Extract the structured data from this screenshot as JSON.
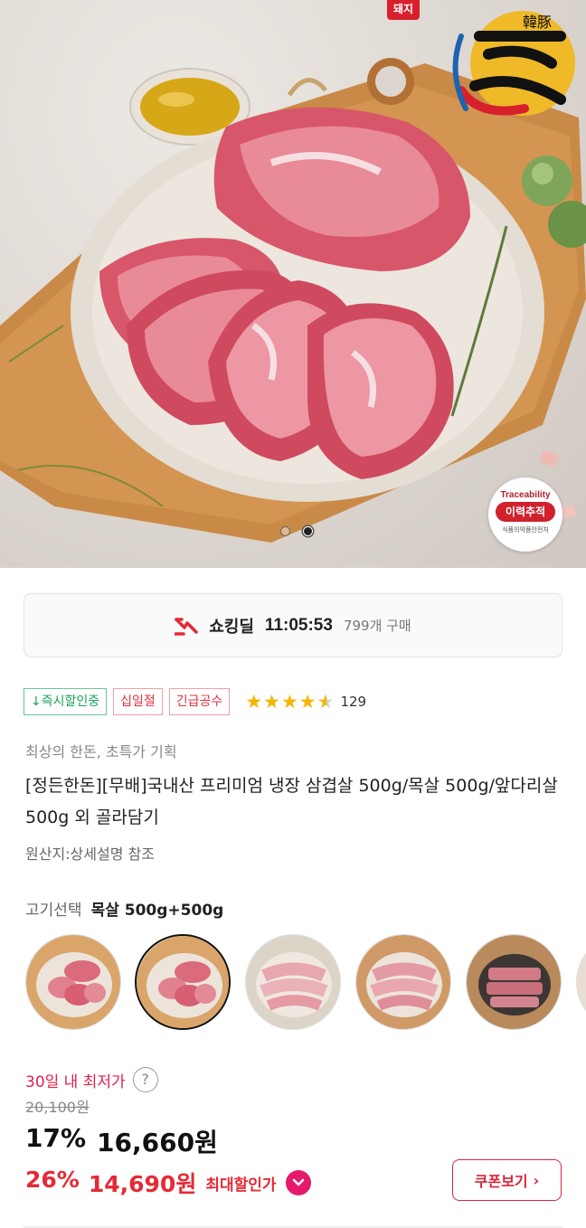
{
  "hero": {
    "brand_tag": "돼지",
    "brand_hanja": "韓豚",
    "brand_name": "한돈",
    "trace_badge_top": "Traceability",
    "trace_badge_main": "이력추적",
    "trace_badge_sub": "식품의약품안전처",
    "slide_count": 2,
    "active_slide": 2
  },
  "deal": {
    "label": "쇼킹딜",
    "timer": "11:05:53",
    "purchase_count": "799개 구매",
    "accent_color": "#e52a35"
  },
  "badges": [
    "↓즉시할인중",
    "십일절",
    "긴급공수"
  ],
  "rating": {
    "stars": 4.5,
    "count": "129"
  },
  "product": {
    "subtitle": "최상의 한돈, 초특가 기획",
    "title": "[정든한돈][무배]국내산 프리미엄 냉장 삼겹살 500g/목살 500g/앞다리살 500g 외 골라담기",
    "origin": "원산지:상세설명 참조"
  },
  "option": {
    "label": "고기선택",
    "value": "목살 500g+500g",
    "thumb_count": 6,
    "selected_index": 1
  },
  "price": {
    "lowest_label": "30일 내 최저가",
    "help_icon": "?",
    "original": "20,100원",
    "discount_rate": "17%",
    "discount_price": "16,660원",
    "max_rate": "26%",
    "max_price": "14,690원",
    "max_label": "최대할인가",
    "max_icon": "chevron-down-icon",
    "coupon_button": "쿠폰보기",
    "coupon_chevron": "›"
  }
}
